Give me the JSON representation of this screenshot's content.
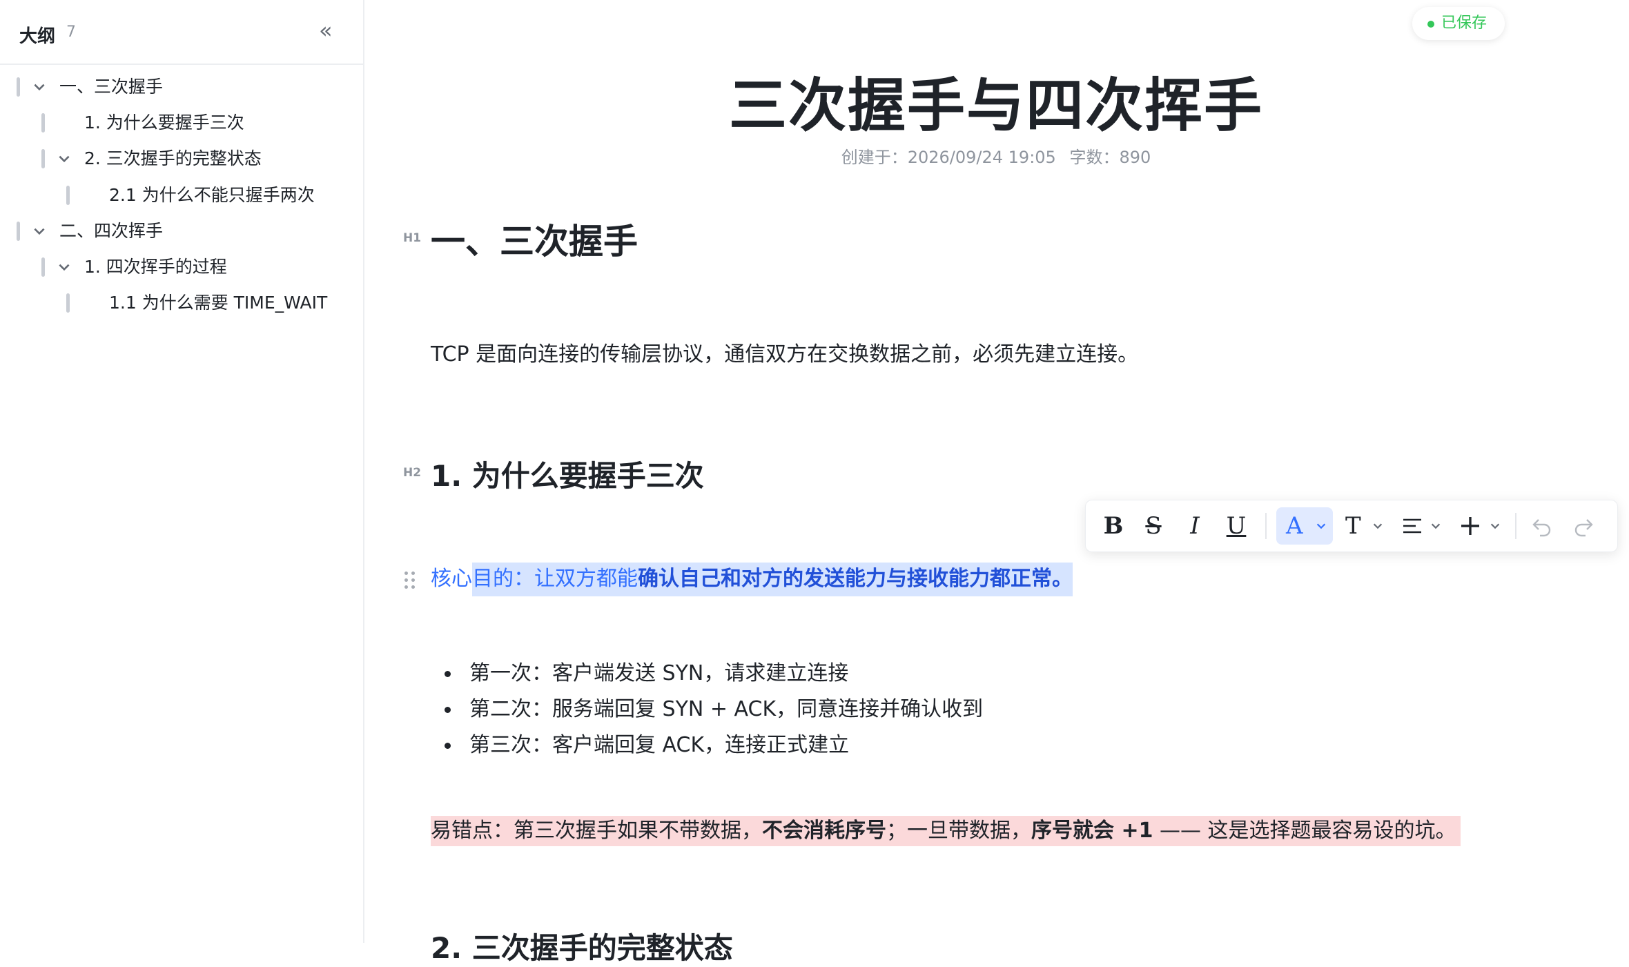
{
  "sidebar": {
    "title": "大纲",
    "count": "7",
    "collapse_icon": "«",
    "items": [
      {
        "label": "一、三次握手",
        "level": 1,
        "expanded": true
      },
      {
        "label": "1. 为什么要握手三次",
        "level": 2,
        "expanded": false
      },
      {
        "label": "2. 三次握手的完整状态",
        "level": 2,
        "expanded": true
      },
      {
        "label": "2.1 为什么不能只握手两次",
        "level": 3,
        "expanded": false
      },
      {
        "label": "二、四次挥手",
        "level": 1,
        "expanded": true
      },
      {
        "label": "1. 四次挥手的过程",
        "level": 2,
        "expanded": true
      },
      {
        "label": "1.1 为什么需要 TIME_WAIT",
        "level": 3,
        "expanded": false
      }
    ]
  },
  "status": {
    "saved": "已保存"
  },
  "doc": {
    "title": "三次握手与四次挥手",
    "created": "创建于：2026/09/24 19:05",
    "word_count": "字数：890",
    "h1_tag": "H1",
    "h1": "一、三次握手",
    "intro": "TCP 是面向连接的传输层协议，通信双方在交换数据之前，必须先建立连接。",
    "h2_tag": "H2",
    "h2": "1. 为什么要握手三次",
    "core_prefix": "核心",
    "core_selected_plain": "目的：让双方都能",
    "core_selected_bold": "确认自己和对方的发送能力与接收能力都正常。",
    "bullets": [
      "第一次：客户端发送 SYN，请求建立连接",
      "第二次：服务端回复 SYN + ACK，同意连接并确认收到",
      "第三次：客户端回复 ACK，连接正式建立"
    ],
    "warn_a": "易错点：第三次握手如果不带数据，",
    "warn_b": "不会消耗序号",
    "warn_c": "；一旦带数据，",
    "warn_d": "序号就会 +1",
    "warn_e": " —— 这是选择题最容易设的坑。",
    "next_h2": "2. 三次握手的完整状态"
  },
  "toolbar": {
    "bold": "B",
    "strike": "S",
    "italic": "I",
    "underline": "U",
    "color": "A",
    "text_style": "T",
    "accent": "#3370ff"
  },
  "colors": {
    "selection": "#d6e4ff",
    "highlight_red": "#fbd9da",
    "saved_green": "#34c759"
  }
}
